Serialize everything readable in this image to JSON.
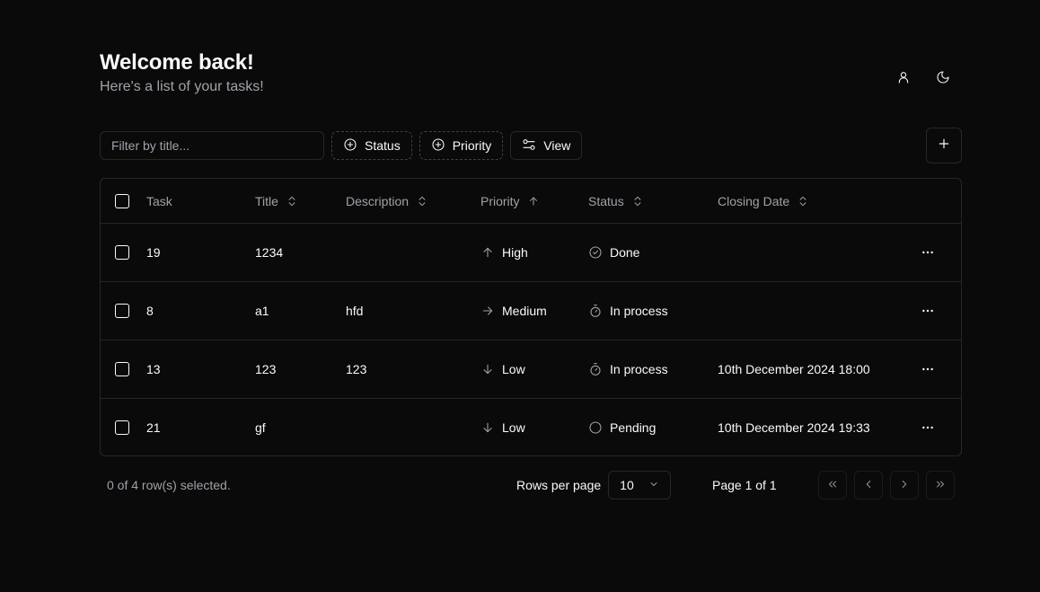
{
  "header": {
    "title": "Welcome back!",
    "subtitle": "Here's a list of your tasks!"
  },
  "top_icons": [
    "user-icon",
    "moon-icon"
  ],
  "toolbar": {
    "filter_placeholder": "Filter by title...",
    "filter_value": "",
    "status_label": "Status",
    "priority_label": "Priority",
    "view_label": "View",
    "add_icon": "plus-icon"
  },
  "table": {
    "columns": {
      "task": "Task",
      "title": "Title",
      "description": "Description",
      "priority": "Priority",
      "status": "Status",
      "closing_date": "Closing Date"
    },
    "rows": [
      {
        "task": "19",
        "title": "1234",
        "description": "",
        "priority": "High",
        "priority_icon": "arrow-up-icon",
        "status": "Done",
        "status_icon": "check-circle-icon",
        "closing_date": ""
      },
      {
        "task": "8",
        "title": "a1",
        "description": "hfd",
        "priority": "Medium",
        "priority_icon": "arrow-right-icon",
        "status": "In process",
        "status_icon": "timer-icon",
        "closing_date": ""
      },
      {
        "task": "13",
        "title": "123",
        "description": "123",
        "priority": "Low",
        "priority_icon": "arrow-down-icon",
        "status": "In process",
        "status_icon": "timer-icon",
        "closing_date": "10th December 2024 18:00"
      },
      {
        "task": "21",
        "title": "gf",
        "description": "",
        "priority": "Low",
        "priority_icon": "arrow-down-icon",
        "status": "Pending",
        "status_icon": "circle-icon",
        "closing_date": "10th December 2024 19:33"
      }
    ]
  },
  "footer": {
    "selected_text": "0 of 4 row(s) selected.",
    "rows_per_page_label": "Rows per page",
    "rows_per_page_value": "10",
    "page_info": "Page 1 of 1"
  },
  "colors": {
    "background": "#0a0a0a",
    "border": "#27272a",
    "text": "#fafafa",
    "muted": "#a1a1aa"
  }
}
